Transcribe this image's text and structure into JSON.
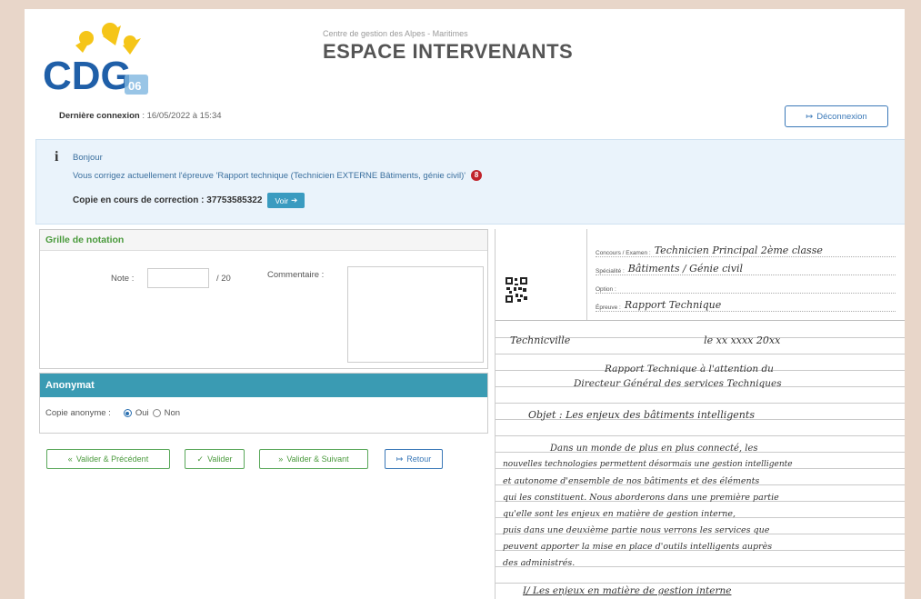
{
  "header": {
    "logo_text": "CDG",
    "logo_badge": "06",
    "subtitle": "Centre de gestion des Alpes - Maritimes",
    "title": "ESPACE INTERVENANTS",
    "last_login_label": "Dernière connexion",
    "last_login_value": ": 16/05/2022 à 15:34",
    "logout_label": "Déconnexion"
  },
  "info": {
    "greeting": "Bonjour",
    "message": "Vous corrigez actuellement l'épreuve 'Rapport technique (Technicien EXTERNE Bâtiments, génie civil)'",
    "badge": "8",
    "copy_label": "Copie en cours de correction : 37753585322",
    "view_button": "Voir"
  },
  "grading": {
    "title": "Grille de notation",
    "note_label": "Note :",
    "note_value": "",
    "note_max": "/ 20",
    "comment_label": "Commentaire :",
    "comment_value": ""
  },
  "anonymat": {
    "title": "Anonymat",
    "label": "Copie anonyme :",
    "options": [
      "Oui",
      "Non"
    ],
    "selected": "Oui"
  },
  "actions": {
    "prev": "Valider & Précédent",
    "validate": "Valider",
    "next": "Valider & Suivant",
    "back": "Retour"
  },
  "document": {
    "fields": [
      {
        "label": "Concours / Examen :",
        "value": "Technicien Principal 2ème classe"
      },
      {
        "label": "Spécialité :",
        "value": "Bâtiments / Génie civil"
      },
      {
        "label": "Option :",
        "value": ""
      },
      {
        "label": "Épreuve :",
        "value": "Rapport Technique"
      }
    ],
    "handwriting": [
      "Technicville                                          le xx xxxx 20xx",
      "Rapport Technique à l'attention du",
      "Directeur Général des services Techniques",
      "Objet : Les enjeux des bâtiments intelligents",
      "Dans un monde de plus en plus connecté, les",
      "nouvelles technologies permettent désormais une gestion intelligente",
      "et autonome d'ensemble de nos bâtiments et des éléments",
      "qui les constituent. Nous aborderons dans une première partie",
      "qu'elle sont les enjeux en matière de gestion interne,",
      "puis dans une deuxième partie nous verrons les services que",
      "peuvent apporter la mise en place d'outils intelligents auprès",
      "des administrés.",
      "I/ Les enjeux en matière de gestion interne"
    ]
  },
  "colors": {
    "accent_blue": "#3b79b8",
    "teal": "#3a9bb3",
    "green": "#4a9a3c",
    "badge_red": "#c0232b",
    "info_bg": "#eaf3fb"
  }
}
